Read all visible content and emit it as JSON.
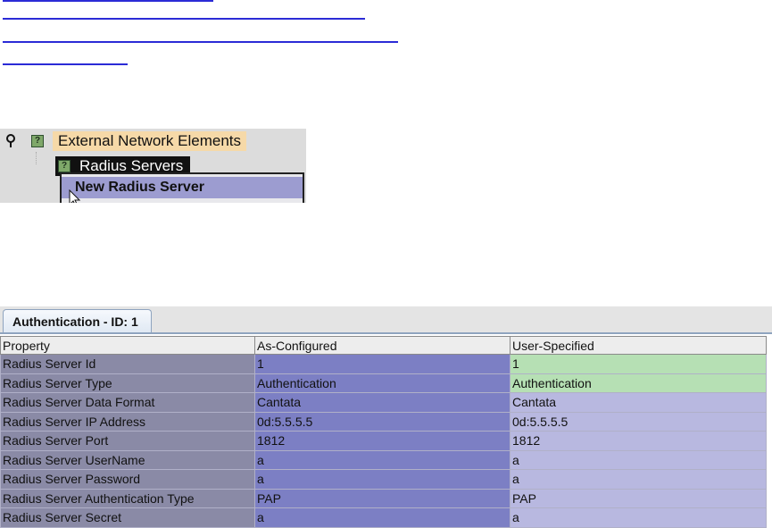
{
  "tree": {
    "root_label": "External Network Elements",
    "child_label": "Radius Servers",
    "node_icon_glyph": "?",
    "context_menu": {
      "new_radius_server": "New Radius Server"
    }
  },
  "tab": {
    "label": "Authentication - ID: 1"
  },
  "table": {
    "headers": [
      "Property",
      "As-Configured",
      "User-Specified"
    ],
    "rows": [
      [
        "Radius Server Id",
        "1",
        "1"
      ],
      [
        "Radius Server Type",
        "Authentication",
        "Authentication"
      ],
      [
        "Radius Server Data Format",
        "Cantata",
        "Cantata"
      ],
      [
        "Radius Server IP Address",
        "0d:5.5.5.5",
        "0d:5.5.5.5"
      ],
      [
        "Radius Server Port",
        "1812",
        "1812"
      ],
      [
        "Radius Server UserName",
        "a",
        "a"
      ],
      [
        "Radius Server Password",
        "a",
        "a"
      ],
      [
        "Radius Server Authentication Type",
        "PAP",
        "PAP"
      ],
      [
        "Radius Server Secret",
        "a",
        "a"
      ]
    ]
  },
  "colors": {
    "link": "#2b2bd6",
    "highlight_green": "#b6e0b4",
    "configured_blue": "#7c7fc4",
    "property_gray": "#8a8aa6"
  }
}
